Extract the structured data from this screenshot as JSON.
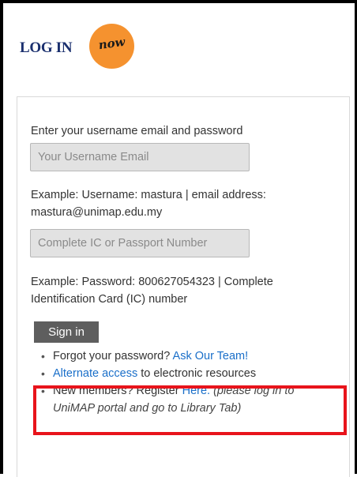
{
  "logo": {
    "text": "LOG IN",
    "badge": "now"
  },
  "login": {
    "prompt": "Enter your username email and password",
    "username_placeholder": "Your Username Email",
    "username_example_line1": "Example: Username: mastura | email address:",
    "username_example_line2": "mastura@unimap.edu.my",
    "password_placeholder": "Complete IC or Passport Number",
    "password_example_line1": "Example: Password: 800627054323 | Complete",
    "password_example_line2": "Identification Card (IC) number",
    "signin_label": "Sign in"
  },
  "links": {
    "forgot_text": "Forgot your password?",
    "forgot_link": "Ask Our Team!",
    "alternate_link": "Alternate access",
    "alternate_text": "to electronic resources",
    "register_text": "New members? Register",
    "register_link": "Here.",
    "register_note_line1": "(please log in to",
    "register_note_line2": "UniMAP portal and go to Library Tab)"
  },
  "colors": {
    "highlight": "#e8141b",
    "link": "#1a6fc9",
    "button": "#5e5e5e",
    "badge": "#f5922f"
  }
}
